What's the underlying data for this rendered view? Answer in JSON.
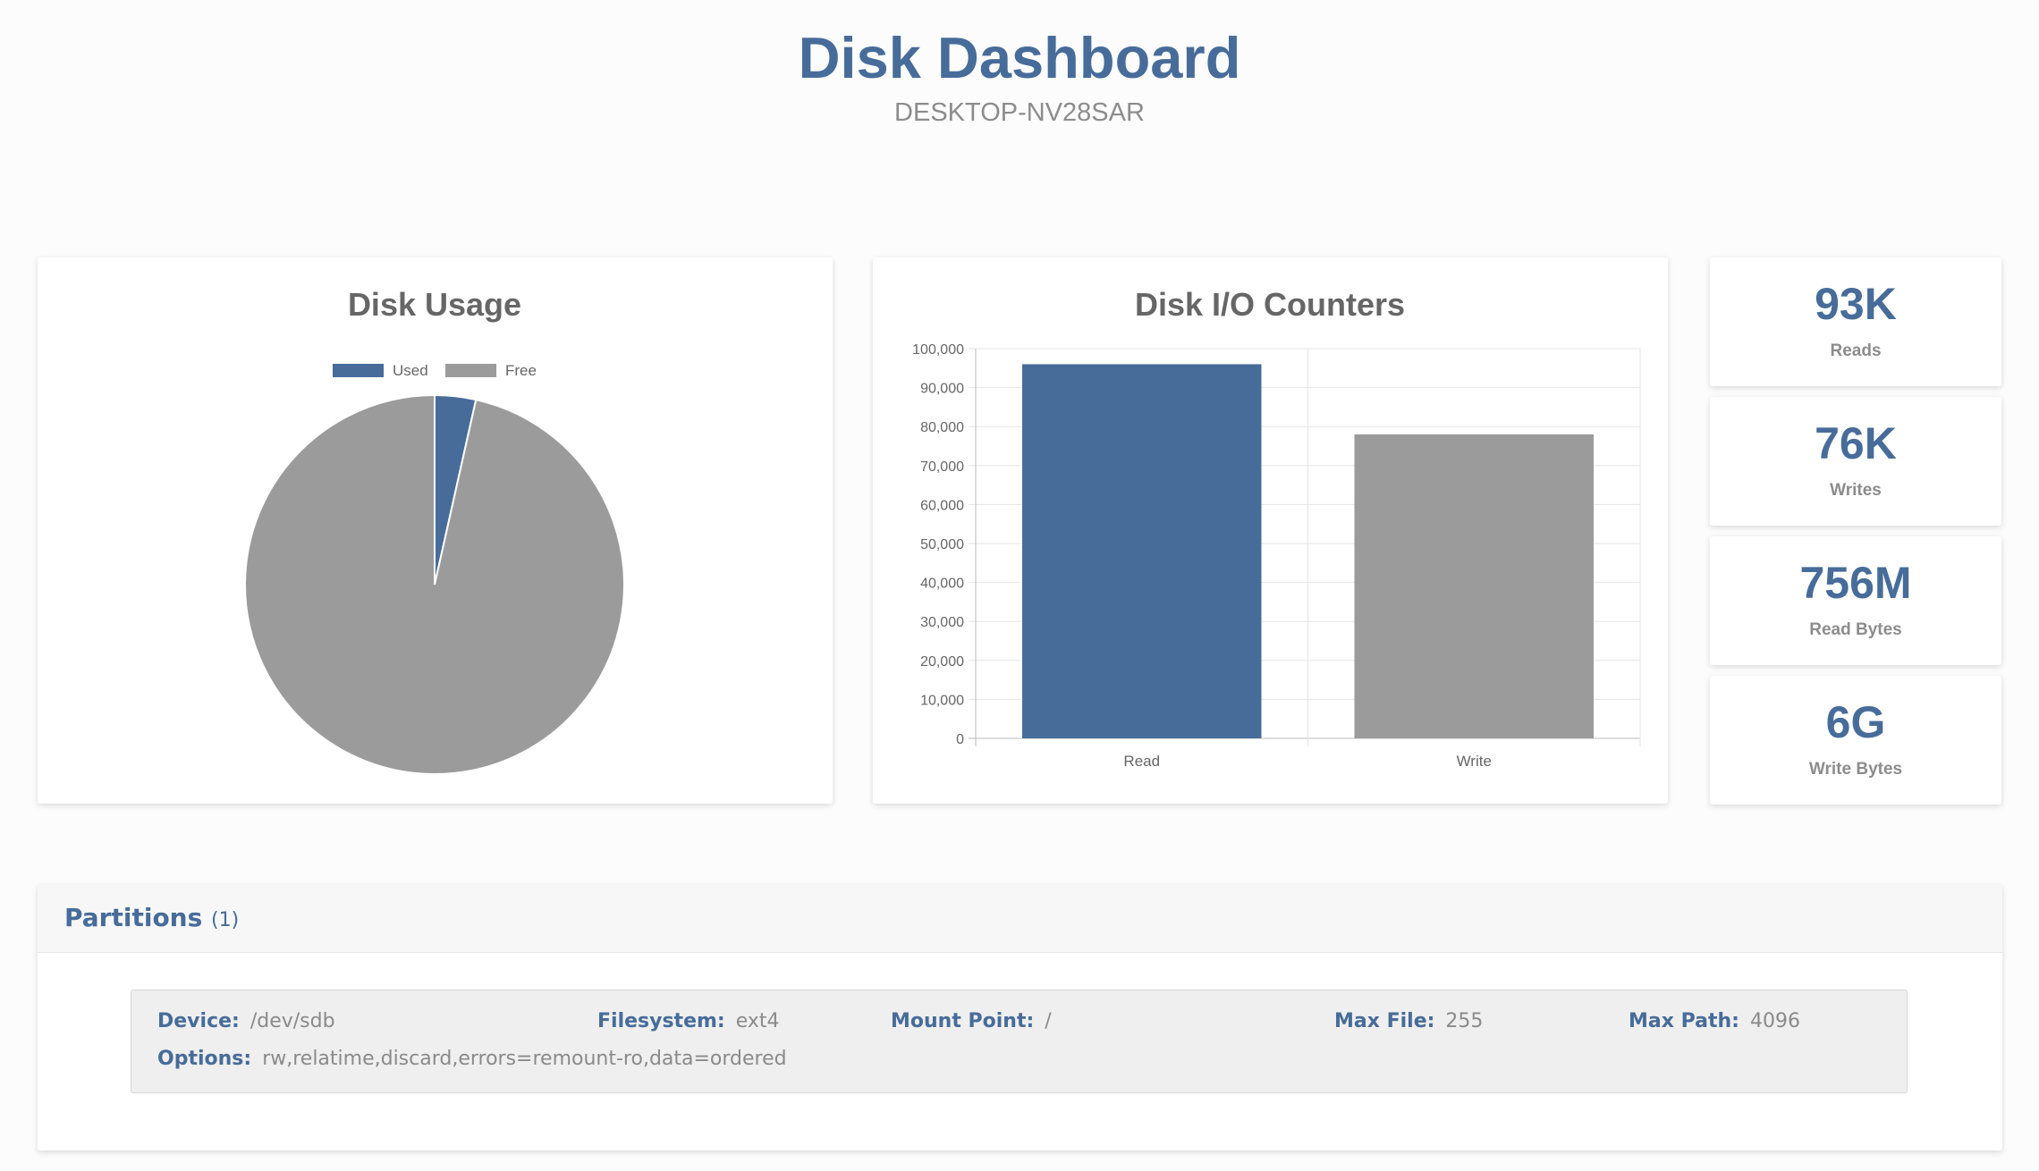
{
  "header": {
    "title": "Disk Dashboard",
    "subtitle": "DESKTOP-NV28SAR"
  },
  "chart_data": [
    {
      "type": "pie",
      "title": "Disk Usage",
      "legend_position": "top",
      "labels": [
        "Used",
        "Free"
      ],
      "values": [
        3.5,
        96.5
      ],
      "colors": [
        "#476c99",
        "#9b9b9b"
      ]
    },
    {
      "type": "bar",
      "title": "Disk I/O Counters",
      "categories": [
        "Read",
        "Write"
      ],
      "values": [
        96000,
        78000
      ],
      "colors": [
        "#476c99",
        "#9b9b9b"
      ],
      "ylim": [
        0,
        100000
      ],
      "yticks": [
        "0",
        "10,000",
        "20,000",
        "30,000",
        "40,000",
        "50,000",
        "60,000",
        "70,000",
        "80,000",
        "90,000",
        "100,000"
      ],
      "grid": true
    }
  ],
  "stats": [
    {
      "value": "93K",
      "label": "Reads"
    },
    {
      "value": "76K",
      "label": "Writes"
    },
    {
      "value": "756M",
      "label": "Read Bytes"
    },
    {
      "value": "6G",
      "label": "Write Bytes"
    }
  ],
  "partitions": {
    "title": "Partitions",
    "count": "(1)",
    "items": [
      {
        "device_label": "Device:",
        "device": "/dev/sdb",
        "filesystem_label": "Filesystem:",
        "filesystem": "ext4",
        "mount_label": "Mount Point:",
        "mount": "/",
        "maxfile_label": "Max File:",
        "maxfile": "255",
        "maxpath_label": "Max Path:",
        "maxpath": "4096",
        "options_label": "Options:",
        "options": "rw,relatime,discard,errors=remount-ro,data=ordered"
      }
    ]
  }
}
